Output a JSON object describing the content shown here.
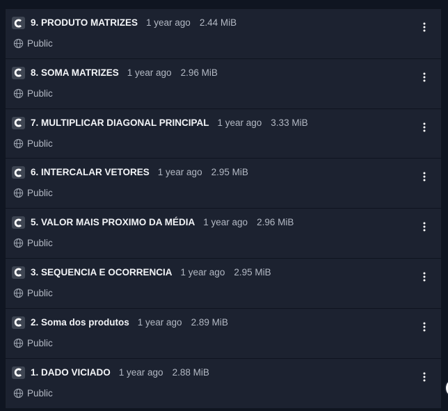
{
  "repos": [
    {
      "name": "9. PRODUTO MATRIZES",
      "updated": "1 year ago",
      "size": "2.44 MiB",
      "visibility": "Public"
    },
    {
      "name": "8. SOMA MATRIZES",
      "updated": "1 year ago",
      "size": "2.96 MiB",
      "visibility": "Public"
    },
    {
      "name": "7. MULTIPLICAR DIAGONAL PRINCIPAL",
      "updated": "1 year ago",
      "size": "3.33 MiB",
      "visibility": "Public"
    },
    {
      "name": "6. INTERCALAR VETORES",
      "updated": "1 year ago",
      "size": "2.95 MiB",
      "visibility": "Public"
    },
    {
      "name": "5. VALOR MAIS PROXIMO DA MÉDIA",
      "updated": "1 year ago",
      "size": "2.96 MiB",
      "visibility": "Public"
    },
    {
      "name": "3. SEQUENCIA E OCORRENCIA",
      "updated": "1 year ago",
      "size": "2.95 MiB",
      "visibility": "Public"
    },
    {
      "name": "2. Soma dos produtos",
      "updated": "1 year ago",
      "size": "2.89 MiB",
      "visibility": "Public"
    },
    {
      "name": "1. DADO VICIADO",
      "updated": "1 year ago",
      "size": "2.88 MiB",
      "visibility": "Public"
    }
  ],
  "icons": {
    "repo": "c-language-icon",
    "visibility": "globe-icon",
    "menu": "kebab-menu-icon"
  },
  "colors": {
    "background": "#0f1521",
    "card": "#1c2230",
    "text_primary": "#f2f4f7",
    "text_secondary": "#b3b9c4"
  }
}
